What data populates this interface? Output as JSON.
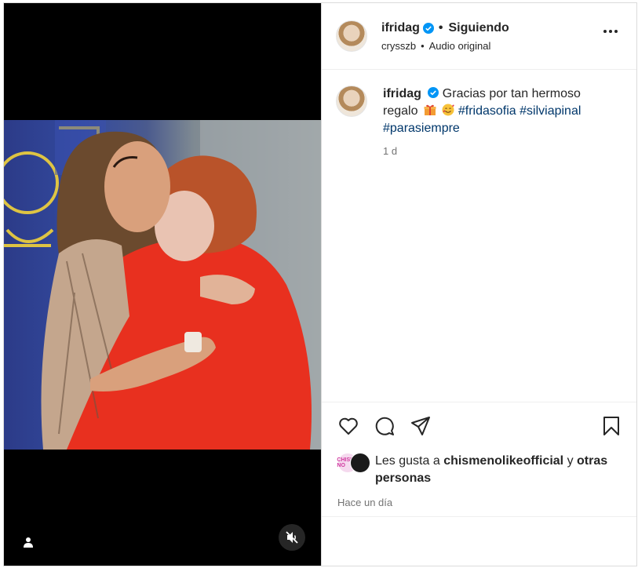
{
  "header": {
    "username": "ifridag",
    "follow_state": "Siguiendo",
    "audio_user": "crysszb",
    "audio_label": "Audio original"
  },
  "caption": {
    "username": "ifridag",
    "text": "Gracias por tan hermoso regalo",
    "emojis": [
      "wrapped-gift-emoji",
      "smiling-face-with-hearts-emoji"
    ],
    "hashtags": [
      "#fridasofia",
      "#silviapinal",
      "#parasiempre"
    ],
    "time": "1 d"
  },
  "likes": {
    "prefix": "Les gusta a",
    "user": "chismenolikeofficial",
    "connector": "y",
    "suffix": "otras personas",
    "avatar_badge": "CHISME NO"
  },
  "post_time": "Hace un día",
  "icons": {
    "verified": "verified-badge-icon",
    "more": "more-options-icon",
    "like": "heart-icon",
    "comment": "comment-icon",
    "share": "share-icon",
    "save": "bookmark-icon",
    "tagged": "user-tag-icon",
    "mute": "muted-speaker-icon"
  },
  "colors": {
    "verified": "#0095f6",
    "hashtag": "#00376b",
    "secondary_text": "#737373",
    "media_background": "#000000"
  }
}
